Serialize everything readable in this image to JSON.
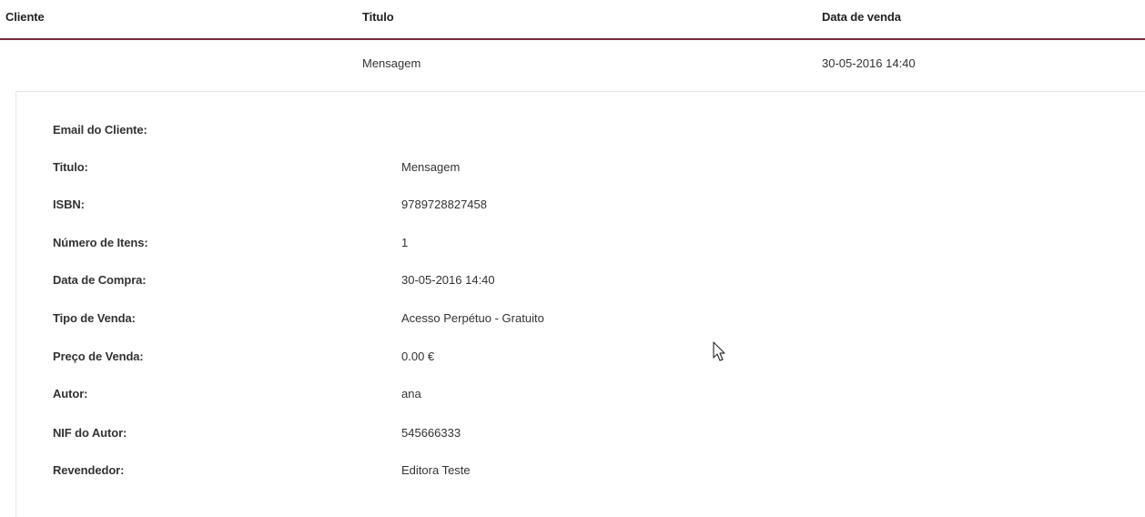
{
  "table": {
    "headers": {
      "client": "Cliente",
      "title": "Titulo",
      "sale_date": "Data de venda"
    },
    "row": {
      "client": "",
      "title": "Mensagem",
      "sale_date": "30-05-2016 14:40"
    }
  },
  "details": [
    {
      "label": "Email do Cliente:",
      "value": ""
    },
    {
      "label": "Titulo:",
      "value": "Mensagem"
    },
    {
      "label": "ISBN:",
      "value": "9789728827458"
    },
    {
      "label": "Número de Itens:",
      "value": "1"
    },
    {
      "label": "Data de Compra:",
      "value": "30-05-2016 14:40"
    },
    {
      "label": "Tipo de Venda:",
      "value": "Acesso Perpétuo - Gratuito"
    },
    {
      "label": "Preço de Venda:",
      "value": "0.00 €"
    },
    {
      "label": "Autor:",
      "value": "ana"
    },
    {
      "label": "NIF do Autor:",
      "value": "545666333"
    },
    {
      "label": "Revendedor:",
      "value": "Editora Teste"
    }
  ],
  "colors": {
    "header_rule": "#7a2b3e",
    "panel_border": "#e6e6e6",
    "text": "#333333"
  },
  "icons": {
    "cursor": "mouse-pointer-icon"
  }
}
